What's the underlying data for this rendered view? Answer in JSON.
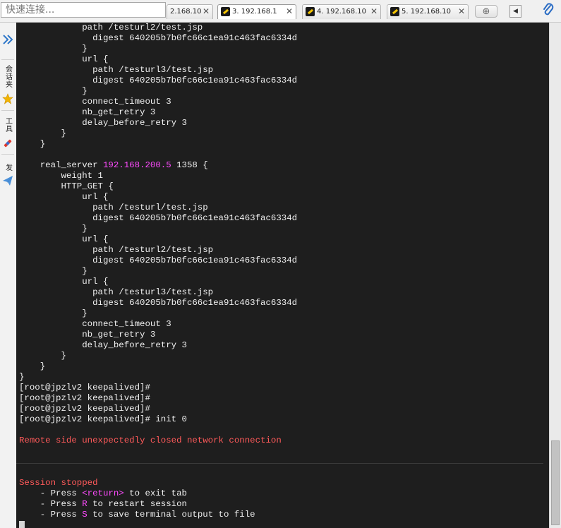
{
  "toolbar": {
    "quick_connect_placeholder": "快速连接...",
    "tabs": [
      {
        "label": "2.168.10"
      },
      {
        "label": "3. 192.168.1"
      },
      {
        "label": "4. 192.168.10"
      },
      {
        "label": "5. 192.168.10"
      }
    ],
    "new_tab_symbol": "⊕",
    "tab_menu_symbol": "◀",
    "attach_symbol": "⌀"
  },
  "sidebar": {
    "expand_symbol": "»",
    "items": [
      {
        "label": "会话夹",
        "icon": "folder-icon"
      },
      {
        "label": "工具",
        "icon": "tools-icon"
      },
      {
        "label": "发",
        "icon": "send-icon"
      }
    ]
  },
  "terminal": {
    "lines": [
      "            path /testurl2/test.jsp",
      "              digest 640205b7b0fc66c1ea91c463fac6334d",
      "            }",
      "            url {",
      "              path /testurl3/test.jsp",
      "              digest 640205b7b0fc66c1ea91c463fac6334d",
      "            }",
      "            connect_timeout 3",
      "            nb_get_retry 3",
      "            delay_before_retry 3",
      "        }",
      "    }",
      "",
      "    real_server ",
      "        weight 1",
      "        HTTP_GET {",
      "            url {",
      "              path /testurl/test.jsp",
      "              digest 640205b7b0fc66c1ea91c463fac6334d",
      "            }",
      "            url {",
      "              path /testurl2/test.jsp",
      "              digest 640205b7b0fc66c1ea91c463fac6334d",
      "            }",
      "            url {",
      "              path /testurl3/test.jsp",
      "              digest 640205b7b0fc66c1ea91c463fac6334d",
      "            }",
      "            connect_timeout 3",
      "            nb_get_retry 3",
      "            delay_before_retry 3",
      "        }",
      "    }",
      "}",
      "[root@jpzlv2 keepalived]#",
      "[root@jpzlv2 keepalived]#",
      "[root@jpzlv2 keepalived]#",
      "[root@jpzlv2 keepalived]# init 0"
    ],
    "real_server_ip": "192.168.200.5",
    "real_server_port": " 1358 {",
    "remote_closed": "Remote side unexpectedly closed network connection",
    "session_stopped": "Session stopped",
    "hint1_prefix": "    - Press ",
    "hint1_key": "<return>",
    "hint1_suffix": " to exit tab",
    "hint2_prefix": "    - Press ",
    "hint2_key": "R",
    "hint2_suffix": " to restart session",
    "hint3_prefix": "    - Press ",
    "hint3_key": "S",
    "hint3_suffix": " to save terminal output to file"
  },
  "colors": {
    "terminal_bg": "#1e1e1e",
    "terminal_fg": "#f0f0f0",
    "ip_highlight": "#ff4bff",
    "error_red": "#ff5a5a"
  }
}
